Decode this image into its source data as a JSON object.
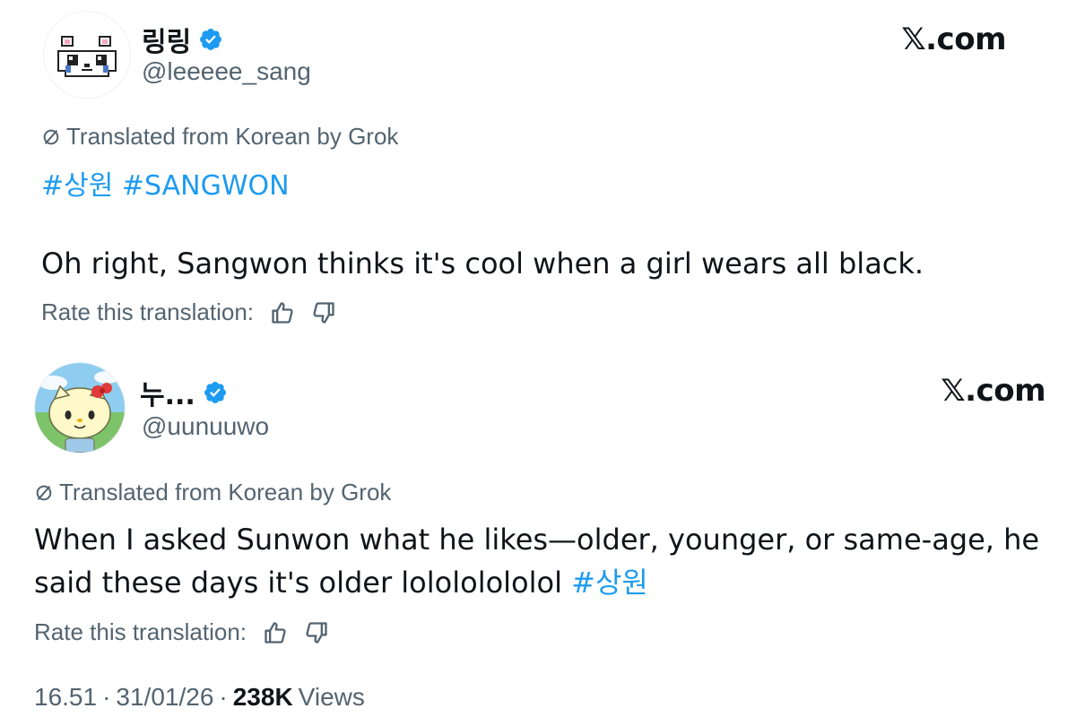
{
  "tweets": [
    {
      "display_name": "링링",
      "handle": "@leeeee_sang",
      "site_label": "𝕏.com",
      "translated_label": "Translated from Korean by Grok",
      "hashtag_1": "#상원",
      "hashtag_2": "#SANGWON",
      "text": "Oh right, Sangwon thinks it's cool when a girl wears all black.",
      "rate_label": "Rate this translation:",
      "avatar_icon": "pixel-hamster-icon"
    },
    {
      "display_name": "누...",
      "handle": "@uunuuwo",
      "site_label": "𝕏.com",
      "translated_label": "Translated from Korean by Grok",
      "text_line_1": "When I asked Sunwon what he likes—older, younger, or same-age, he",
      "text_line_2": "said these days it's older lolololololol",
      "hashtag_1": "#상원",
      "rate_label": "Rate this translation:",
      "avatar_icon": "hello-kitty-style-character-icon"
    }
  ],
  "footer": {
    "time": "16.51",
    "date": "31/01/26",
    "separator": "·",
    "views_count": "238K",
    "views_label": "Views"
  },
  "colors": {
    "hashtag": "#1d9bf0",
    "verified": "#1d9bf0",
    "secondary_text": "#536471",
    "primary_text": "#0f1419"
  }
}
